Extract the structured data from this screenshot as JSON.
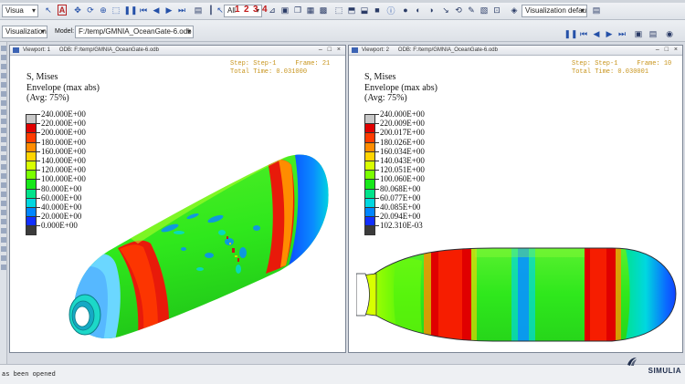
{
  "toolbar": {
    "view_combo": "Visua",
    "filter_combo": "All",
    "step_numbers": [
      "1",
      "2",
      "3",
      "4"
    ],
    "defaults_combo": "Visualization defaults"
  },
  "secondbar": {
    "module_combo": "Visualization",
    "model_label": "Model:",
    "model_path": "F:/temp/GMNIA_OceanGate-6.odb"
  },
  "viewport1": {
    "title": "Viewport: 1",
    "odb": "ODB: F:/temp/GMNIA_OceanGate-6.odb",
    "step_line": "Step: Step-1     Frame: 21",
    "time_line": "Total Time: 0.031000",
    "legend_title": "S, Mises",
    "legend_envelope": "Envelope (max abs)",
    "legend_avg": "(Avg: 75%)",
    "legend_values": [
      "240.000E+00",
      "220.000E+00",
      "200.000E+00",
      "180.000E+00",
      "160.000E+00",
      "140.000E+00",
      "120.000E+00",
      "100.000E+00",
      "80.000E+00",
      "60.000E+00",
      "40.000E+00",
      "20.000E+00",
      "0.000E+00"
    ]
  },
  "viewport2": {
    "title": "Viewport: 2",
    "odb": "ODB: F:/temp/GMNIA_OceanGate-6.odb",
    "step_line": "Step: Step-1     Frame: 10",
    "time_line": "Total Time: 0.030001",
    "legend_title": "S, Mises",
    "legend_envelope": "Envelope (max abs)",
    "legend_avg": "(Avg: 75%)",
    "legend_values": [
      "240.000E+00",
      "220.009E+00",
      "200.017E+00",
      "180.026E+00",
      "160.034E+00",
      "140.043E+00",
      "120.051E+00",
      "100.060E+00",
      "80.068E+00",
      "60.077E+00",
      "40.085E+00",
      "20.094E+00",
      "102.310E-03"
    ]
  },
  "legend_colors": [
    "#c8c8c8",
    "#e00000",
    "#ff3b00",
    "#ff8c00",
    "#ffd400",
    "#d8ff00",
    "#7aff00",
    "#17e81a",
    "#00e38a",
    "#00d7e0",
    "#0086ff",
    "#1230ff",
    "#3b3b3b"
  ],
  "status": {
    "message": "as been opened",
    "brand": "SIMULIA"
  }
}
